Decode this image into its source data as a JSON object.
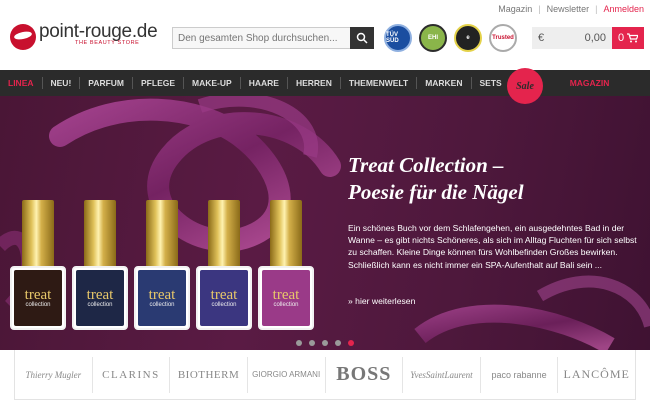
{
  "topbar": {
    "links": [
      "Magazin",
      "Newsletter",
      "Anmelden"
    ]
  },
  "logo": {
    "name": "point-rouge.de",
    "tagline": "THE BEAUTY STORE"
  },
  "search": {
    "placeholder": "Den gesamten Shop durchsuchen..."
  },
  "badges": [
    "TÜV SÜD",
    "EHI",
    "e",
    "Trusted"
  ],
  "cart": {
    "currency": "€",
    "amount": "0,00",
    "count": "0"
  },
  "nav": {
    "items": [
      "LINEA",
      "NEU!",
      "PARFUM",
      "PFLEGE",
      "MAKE-UP",
      "HAARE",
      "HERREN",
      "THEMENWELT",
      "MARKEN",
      "SETS"
    ],
    "sale": "Sale",
    "magazin": "MAGAZIN"
  },
  "hero": {
    "title_line1": "Treat Collection –",
    "title_line2": "Poesie für die Nägel",
    "text": "Ein schönes Buch vor dem Schlafengehen, ein ausgedehntes Bad in der Wanne – es gibt nichts Schöneres, als sich im Alltag Fluchten für sich selbst zu schaffen. Kleine Dinge können fürs Wohlbefinden Großes bewirken. Schließlich kann es nicht immer ein SPA-Aufenthalt auf Bali sein ...",
    "more": "» hier weiterlesen",
    "bottles": [
      {
        "label": "treat",
        "sub": "collection",
        "color": "#2e1a14"
      },
      {
        "label": "treat",
        "sub": "collection",
        "color": "#1e2746"
      },
      {
        "label": "treat",
        "sub": "collection",
        "color": "#2a3a72"
      },
      {
        "label": "treat",
        "sub": "collection",
        "color": "#3b3680"
      },
      {
        "label": "treat",
        "sub": "collection",
        "color": "#9a3a88"
      }
    ],
    "active_slide": 5,
    "slide_count": 5
  },
  "brands": [
    "Thierry Mugler",
    "CLARINS",
    "BIOTHERM",
    "GIORGIO ARMANI",
    "BOSS",
    "YvesSaintLaurent",
    "paco rabanne",
    "LANCÔME"
  ],
  "colors": {
    "accent": "#e4244d",
    "nav_bg": "#2b2b2b",
    "hero_bg": "#4e183c"
  }
}
